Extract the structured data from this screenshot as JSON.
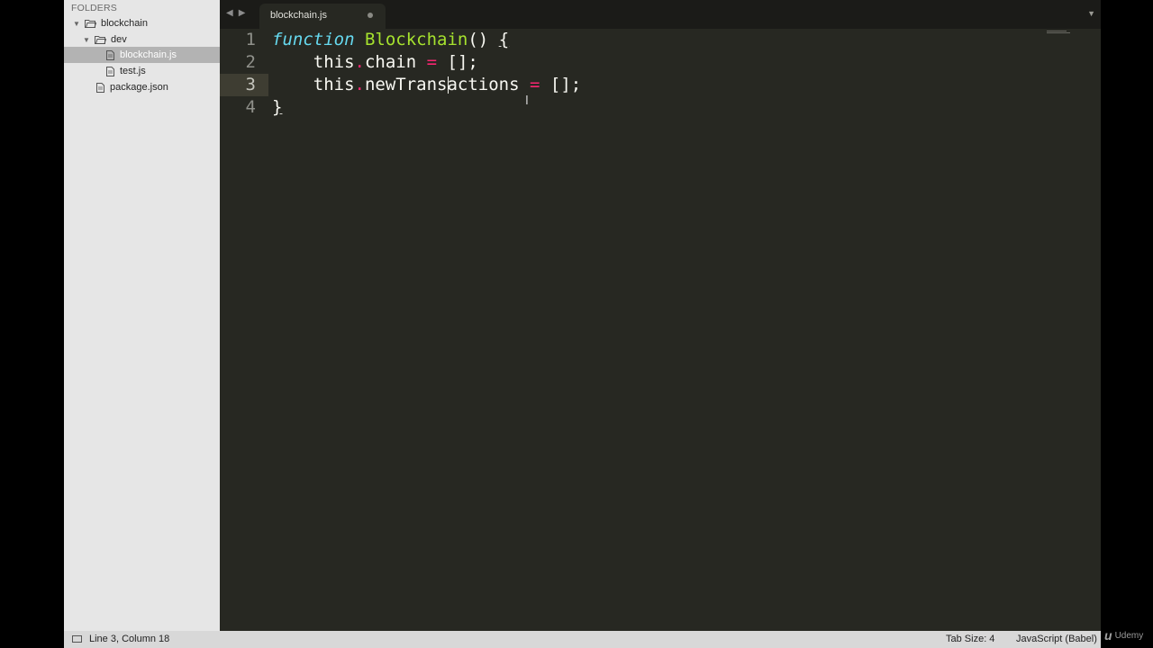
{
  "sidebar": {
    "heading": "FOLDERS",
    "tree": [
      {
        "label": "blockchain",
        "type": "folder",
        "expanded": true
      },
      {
        "label": "dev",
        "type": "folder",
        "expanded": true
      },
      {
        "label": "blockchain.js",
        "type": "file",
        "selected": true
      },
      {
        "label": "test.js",
        "type": "file"
      },
      {
        "label": "package.json",
        "type": "file"
      }
    ]
  },
  "tabbar": {
    "back_icon": "chevron-left-icon",
    "forward_icon": "chevron-right-icon",
    "tabs": [
      {
        "label": "blockchain.js",
        "dirty": true,
        "active": true
      }
    ],
    "menu_icon": "triangle-down-icon"
  },
  "editor": {
    "line_numbers": [
      "1",
      "2",
      "3",
      "4"
    ],
    "current_line": 3,
    "lines": [
      {
        "tokens": [
          {
            "t": "function",
            "c": "kw-storage"
          },
          {
            "t": " ",
            "c": ""
          },
          {
            "t": "Blockchain",
            "c": "fn-name"
          },
          {
            "t": "() ",
            "c": ""
          },
          {
            "t": "{",
            "c": "underlined"
          }
        ]
      },
      {
        "tokens": [
          {
            "t": "    this",
            "c": "var-this"
          },
          {
            "t": ".",
            "c": "op"
          },
          {
            "t": "chain ",
            "c": ""
          },
          {
            "t": "=",
            "c": "op"
          },
          {
            "t": " [];",
            "c": ""
          }
        ]
      },
      {
        "tokens": [
          {
            "t": "    this",
            "c": "var-this"
          },
          {
            "t": ".",
            "c": "op"
          },
          {
            "t": "newTrans",
            "c": ""
          },
          {
            "t": "actions ",
            "c": ""
          },
          {
            "t": "=",
            "c": "op"
          },
          {
            "t": " [];",
            "c": ""
          }
        ]
      },
      {
        "tokens": [
          {
            "t": "}",
            "c": "underlined"
          }
        ]
      }
    ],
    "colors": {
      "background": "#272822",
      "keyword": "#66d9ef",
      "function": "#a6e22e",
      "operator": "#f92672",
      "text": "#f8f8f2"
    }
  },
  "statusbar": {
    "position": "Line 3, Column 18",
    "tab_size": "Tab Size: 4",
    "syntax": "JavaScript (Babel)"
  },
  "watermark": {
    "text": "Udemy"
  }
}
